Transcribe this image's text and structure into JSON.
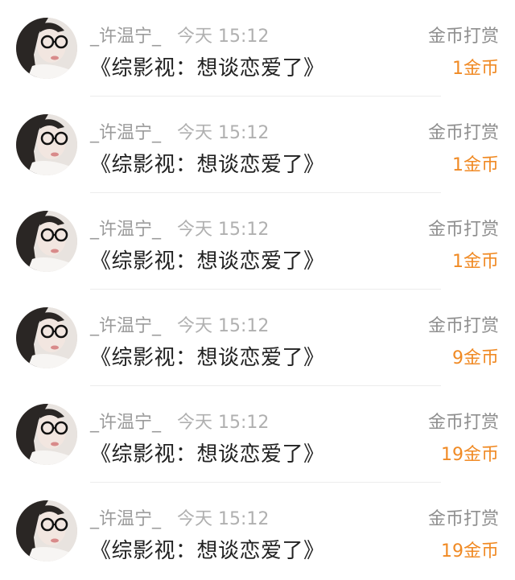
{
  "colors": {
    "username": "#9b9b9b",
    "time": "#b0b0b0",
    "title": "#222222",
    "type": "#8f8f8f",
    "amount": "#f08a24",
    "divider": "#ececec"
  },
  "rewards": [
    {
      "username": "_许温宁_",
      "time": "今天 15:12",
      "title": "《综影视：想谈恋爱了》",
      "type": "金币打赏",
      "amount": "1金币"
    },
    {
      "username": "_许温宁_",
      "time": "今天 15:12",
      "title": "《综影视：想谈恋爱了》",
      "type": "金币打赏",
      "amount": "1金币"
    },
    {
      "username": "_许温宁_",
      "time": "今天 15:12",
      "title": "《综影视：想谈恋爱了》",
      "type": "金币打赏",
      "amount": "1金币"
    },
    {
      "username": "_许温宁_",
      "time": "今天 15:12",
      "title": "《综影视：想谈恋爱了》",
      "type": "金币打赏",
      "amount": "9金币"
    },
    {
      "username": "_许温宁_",
      "time": "今天 15:12",
      "title": "《综影视：想谈恋爱了》",
      "type": "金币打赏",
      "amount": "19金币"
    },
    {
      "username": "_许温宁_",
      "time": "今天 15:12",
      "title": "《综影视：想谈恋爱了》",
      "type": "金币打赏",
      "amount": "19金币"
    }
  ]
}
